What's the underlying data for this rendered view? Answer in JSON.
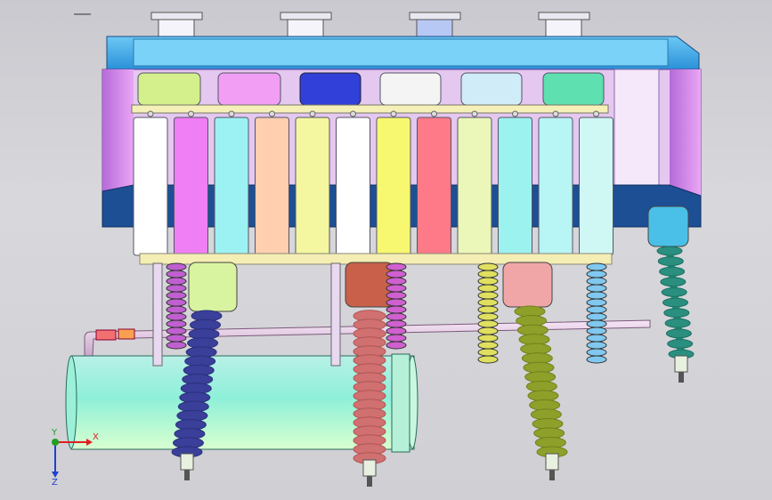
{
  "triad": {
    "x_label": "X",
    "y_label": "Y",
    "z_label": "Z"
  },
  "colors": {
    "background": "#d0d0d5",
    "cover": "#3aa8e6",
    "base": "#1e4d8c",
    "side_panel": "#d98ce8",
    "tank": "#7fe6d8",
    "axis_x": "#e02020",
    "axis_y": "#20a020",
    "axis_z": "#2040d0"
  },
  "bushings": [
    {
      "name": "bushing-left-blue",
      "color": "#3a3f9a",
      "shed": "#2a2f7a"
    },
    {
      "name": "bushing-center-red",
      "color": "#d07070",
      "shed": "#b05555"
    },
    {
      "name": "bushing-right-olive",
      "color": "#8fa02a",
      "shed": "#6f801a"
    },
    {
      "name": "bushing-far-right-teal",
      "color": "#2a8f7f",
      "shed": "#1a6f60"
    }
  ],
  "cells": [
    "#ffffff",
    "#f07ef5",
    "#9cf2f2",
    "#ffcfb0",
    "#f5f7a0",
    "#ffffff",
    "#f8f870",
    "#ff7a88",
    "#eaf7b8",
    "#9cf2ee",
    "#b8f5f5",
    "#cff7f4"
  ]
}
